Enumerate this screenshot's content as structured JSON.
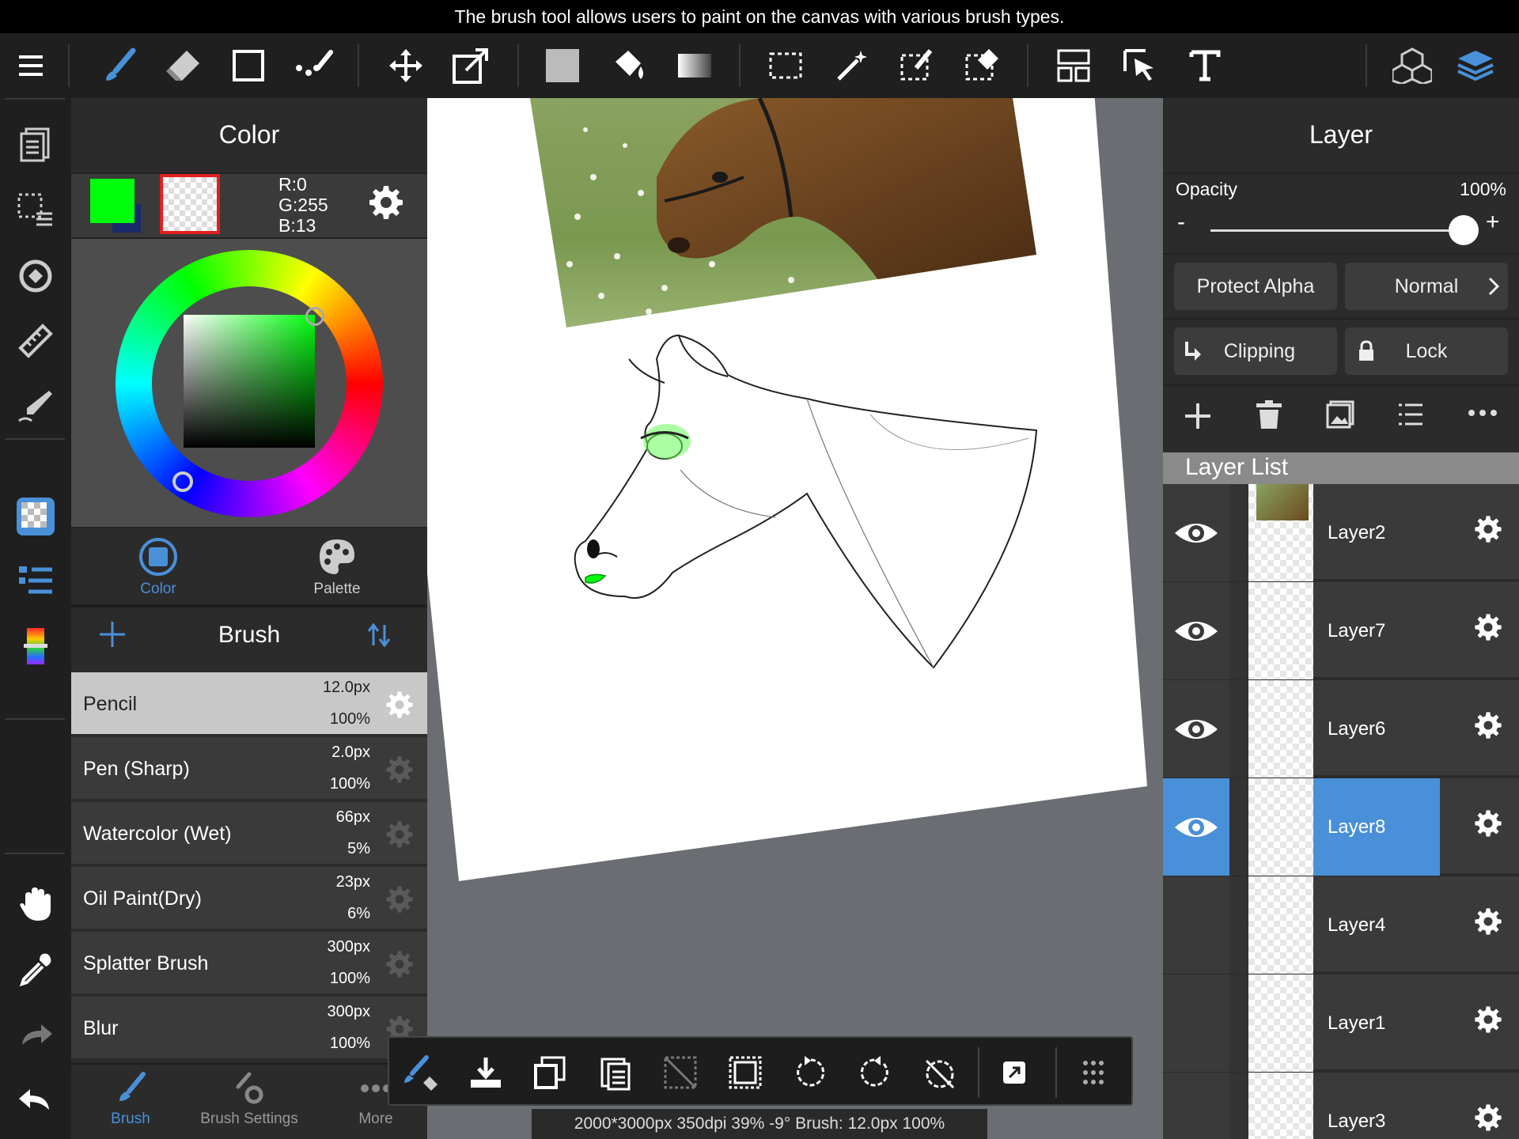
{
  "tooltip": "The brush tool allows users to paint on the canvas with various brush types.",
  "toolbar": {
    "tools": [
      "menu-icon",
      "brush-icon",
      "eraser-icon",
      "rectangle-shape-icon",
      "dot-brush-icon",
      "move-icon",
      "transform-icon",
      "fill-color-icon",
      "bucket-icon",
      "gradient-icon",
      "select-rectangle-icon",
      "magic-wand-icon",
      "select-pen-icon",
      "select-eraser-icon",
      "frame-divider-icon",
      "operation-icon",
      "text-icon",
      "3d-model-icon",
      "layers-icon"
    ]
  },
  "color_panel": {
    "title": "Color",
    "primary_color": "#00FF0D",
    "rgb": {
      "r": "R:0",
      "g": "G:255",
      "b": "B:13"
    },
    "tabs": [
      {
        "label": "Color",
        "active": true
      },
      {
        "label": "Palette",
        "active": false
      }
    ]
  },
  "brush_panel": {
    "title": "Brush",
    "brushes": [
      {
        "name": "Pencil",
        "size": "12.0px",
        "opacity": "100%",
        "selected": true
      },
      {
        "name": "Pen (Sharp)",
        "size": "2.0px",
        "opacity": "100%"
      },
      {
        "name": "Watercolor (Wet)",
        "size": "66px",
        "opacity": "5%"
      },
      {
        "name": "Oil Paint(Dry)",
        "size": "23px",
        "opacity": "6%"
      },
      {
        "name": "Splatter Brush",
        "size": "300px",
        "opacity": "100%"
      },
      {
        "name": "Blur",
        "size": "300px",
        "opacity": "100%"
      }
    ],
    "bottom_tabs": [
      {
        "label": "Brush",
        "active": true
      },
      {
        "label": "Brush Settings"
      },
      {
        "label": "More"
      }
    ]
  },
  "layer_panel": {
    "title": "Layer",
    "opacity_label": "Opacity",
    "opacity_value": "100%",
    "opacity_fraction": 1.0,
    "minus": "-",
    "plus": "+",
    "protect_alpha": "Protect Alpha",
    "blend_mode": "Normal",
    "clipping": "Clipping",
    "lock": "Lock",
    "list_title": "Layer List",
    "layers": [
      {
        "name": "Layer2",
        "visible": true
      },
      {
        "name": "Layer7",
        "visible": true
      },
      {
        "name": "Layer6",
        "visible": true
      },
      {
        "name": "Layer8",
        "visible": true,
        "selected": true
      },
      {
        "name": "Layer4",
        "visible": false
      },
      {
        "name": "Layer1",
        "visible": false
      },
      {
        "name": "Layer3",
        "visible": false
      }
    ]
  },
  "status": "2000*3000px 350dpi 39% -9° Brush: 12.0px 100%",
  "colors": {
    "accent": "#4A90D9",
    "selected_layer": "#4A90D9",
    "toolbar_bg": "#1F1F1F",
    "panel_bg": "#2B2B2B"
  }
}
